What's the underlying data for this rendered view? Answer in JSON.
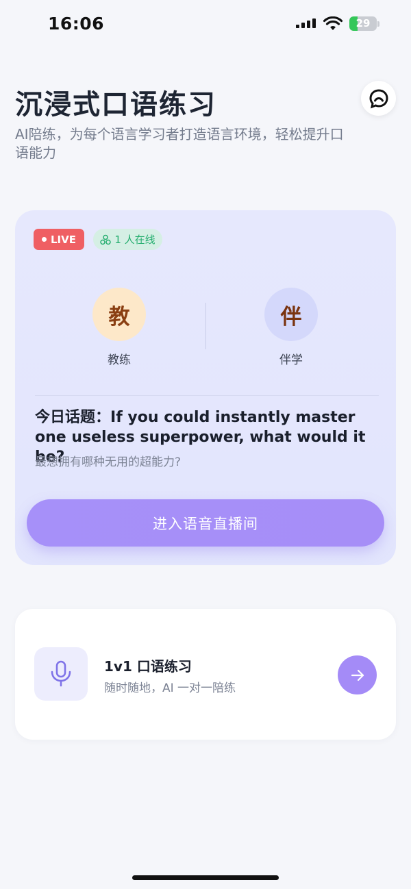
{
  "status_bar": {
    "time": "16:06",
    "battery": "29"
  },
  "header": {
    "title": "沉浸式口语练习",
    "subtitle": "AI陪练，为每个语言学习者打造语言环境，轻松提升口语能力",
    "action_icon": "chat-bubble-icon"
  },
  "live_card": {
    "live_label": "LIVE",
    "online_label": "1 人在线",
    "roles": [
      {
        "avatar_char": "教",
        "label": "教练",
        "avatar_bg": "#fde8c9",
        "avatar_color": "#8a3f12"
      },
      {
        "avatar_char": "伴",
        "label": "伴学",
        "avatar_bg": "#d4d8fb",
        "avatar_color": "#7a3410"
      }
    ],
    "topic_prefix": "今日话题：",
    "topic_text": "If you could instantly master one useless superpower, what would it be?",
    "topic_translation": "最想拥有哪种无用的超能力?",
    "enter_button_label": "进入语音直播间"
  },
  "practice_card": {
    "icon": "microphone-icon",
    "title": "1v1 口语练习",
    "subtitle": "随时随地，AI 一对一陪练",
    "arrow_icon": "arrow-right-icon"
  },
  "colors": {
    "live_red": "#ef5f63",
    "online_green": "#27ae70",
    "accent_purple": "#a48bf7",
    "card_lavender": "#e4e7fd"
  }
}
